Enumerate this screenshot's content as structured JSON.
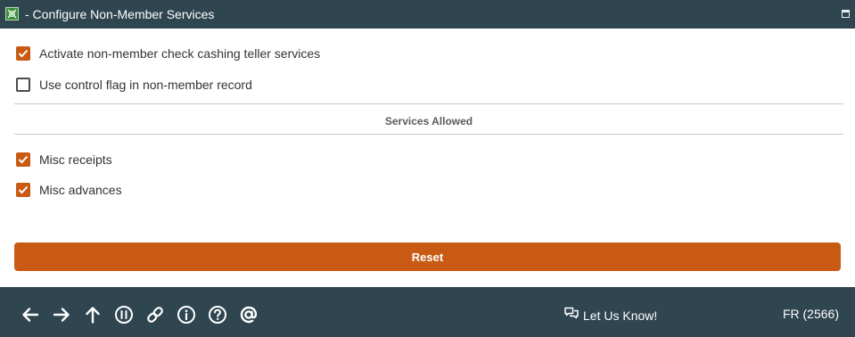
{
  "window": {
    "title": "- Configure Non-Member Services",
    "icon": "app-logo-icon"
  },
  "settings": {
    "activate_label": "Activate non-member check cashing teller services",
    "activate_checked": true,
    "control_flag_label": "Use control flag in non-member record",
    "control_flag_checked": false
  },
  "services_allowed": {
    "title": "Services Allowed",
    "items": [
      {
        "label": "Misc receipts",
        "checked": true
      },
      {
        "label": "Misc advances",
        "checked": true
      }
    ]
  },
  "actions": {
    "reset_label": "Reset"
  },
  "footer": {
    "nav_icons": [
      "arrow-left-icon",
      "arrow-right-icon",
      "arrow-up-icon",
      "pause-icon",
      "link-icon",
      "info-icon",
      "help-icon",
      "at-icon"
    ],
    "feedback_label": "Let Us Know!",
    "user_code": "FR (2566)"
  },
  "colors": {
    "header_bg": "#2f4550",
    "accent": "#c85a13"
  }
}
